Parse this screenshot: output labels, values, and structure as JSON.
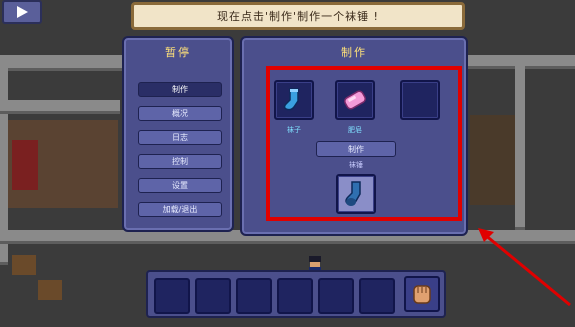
{
  "banner": {
    "text": "现在点击'制作'制作一个袜锤 !"
  },
  "pause_panel": {
    "title": "暂停",
    "menu": [
      {
        "label": "制作",
        "active": true
      },
      {
        "label": "概况",
        "active": false
      },
      {
        "label": "日志",
        "active": false
      },
      {
        "label": "控制",
        "active": false
      },
      {
        "label": "设置",
        "active": false
      },
      {
        "label": "加载/退出",
        "active": false
      }
    ]
  },
  "craft_panel": {
    "title": "制作",
    "ingredients": [
      {
        "label": "袜子",
        "icon": "sock-icon"
      },
      {
        "label": "肥皂",
        "icon": "soap-icon"
      },
      {
        "label": "",
        "icon": "empty-slot"
      }
    ],
    "craft_button": "制作",
    "result_label": "袜锤",
    "result_icon": "sock-mace-icon"
  },
  "hotbar": {
    "slots": 6,
    "equipped_icon": "fist-icon"
  },
  "colors": {
    "highlight": "#e00000",
    "arrow": "#e00000",
    "title": "#ffe27a",
    "item_label": "#7fe0ff"
  }
}
